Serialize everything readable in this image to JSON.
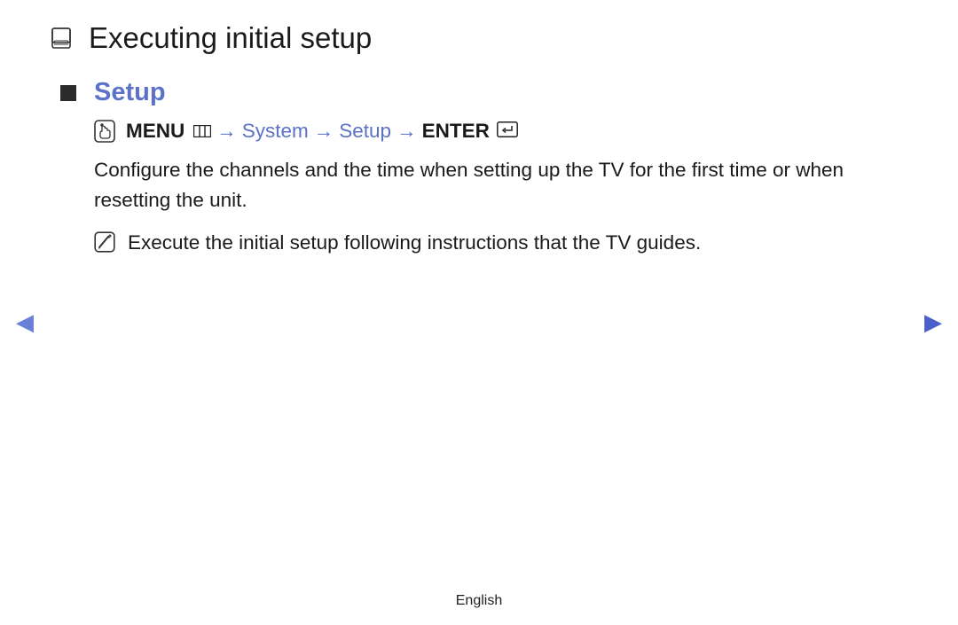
{
  "title": "Executing initial setup",
  "section": {
    "heading": "Setup"
  },
  "navpath": {
    "menu_label": "MENU",
    "arrow": "→",
    "system": "System",
    "setup": "Setup",
    "enter_label": "ENTER"
  },
  "body": {
    "paragraph": "Configure the channels and the time when setting up the TV for the first time or when resetting the unit.",
    "note": "Execute the initial setup following instructions that the TV guides."
  },
  "nav": {
    "prev": "◀",
    "next": "▶"
  },
  "footer": {
    "language": "English"
  }
}
